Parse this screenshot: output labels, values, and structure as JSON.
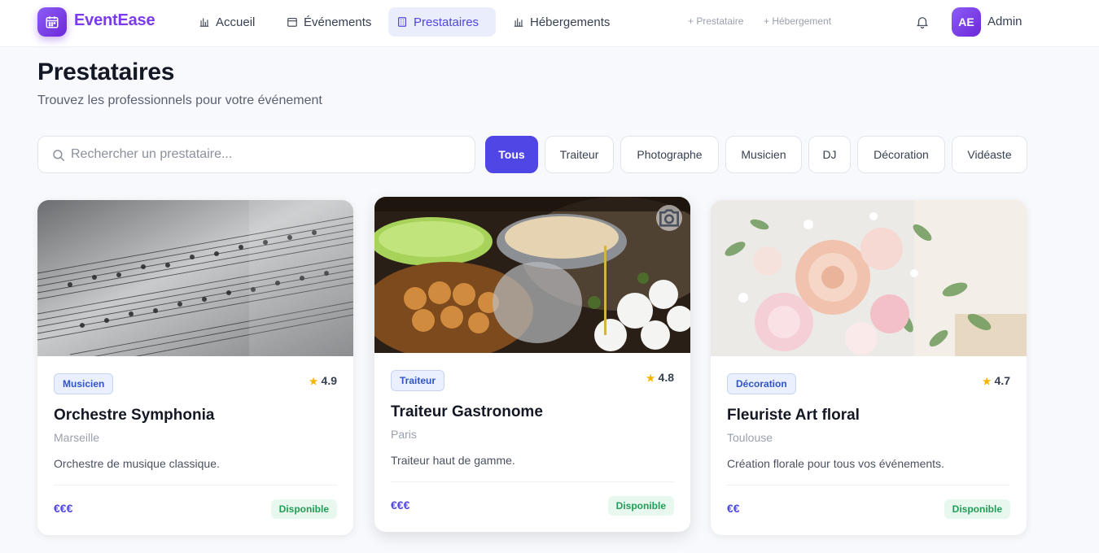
{
  "brand": {
    "name": "EventEase",
    "accent": "#7c3aed",
    "icon": "calendar-icon"
  },
  "nav": [
    {
      "label": "Accueil",
      "icon": "chart-icon",
      "active": false
    },
    {
      "label": "Événements",
      "icon": "calendar-icon",
      "active": false
    },
    {
      "label": "Prestataires",
      "icon": "building-icon",
      "active": true
    },
    {
      "label": "Hébergements",
      "icon": "chart-icon",
      "active": false
    }
  ],
  "quick_actions": [
    "+ Prestataire",
    "+ Hébergement"
  ],
  "user": {
    "initials": "AE",
    "name": "Admin"
  },
  "page": {
    "title": "Prestataires",
    "subtitle": "Trouvez les professionnels pour votre événement"
  },
  "search": {
    "placeholder": "Rechercher un prestataire...",
    "value": ""
  },
  "filters": [
    {
      "label": "Tous",
      "active": true
    },
    {
      "label": "Traiteur",
      "active": false
    },
    {
      "label": "Photographe",
      "active": false
    },
    {
      "label": "Musicien",
      "active": false
    },
    {
      "label": "DJ",
      "active": false
    },
    {
      "label": "Décoration",
      "active": false
    },
    {
      "label": "Vidéaste",
      "active": false
    }
  ],
  "cards": [
    {
      "category": "Musicien",
      "rating": "4.9",
      "name": "Orchestre Symphonia",
      "city": "Marseille",
      "description": "Orchestre de musique classique.",
      "price": "€€€",
      "status": "Disponible",
      "image": "sheet-music"
    },
    {
      "category": "Traiteur",
      "rating": "4.8",
      "name": "Traiteur Gastronome",
      "city": "Paris",
      "description": "Traiteur haut de gamme.",
      "price": "€€€",
      "status": "Disponible",
      "image": "buffet"
    },
    {
      "category": "Décoration",
      "rating": "4.7",
      "name": "Fleuriste Art floral",
      "city": "Toulouse",
      "description": "Création florale pour tous vos événements.",
      "price": "€€",
      "status": "Disponible",
      "image": "flowers"
    }
  ]
}
